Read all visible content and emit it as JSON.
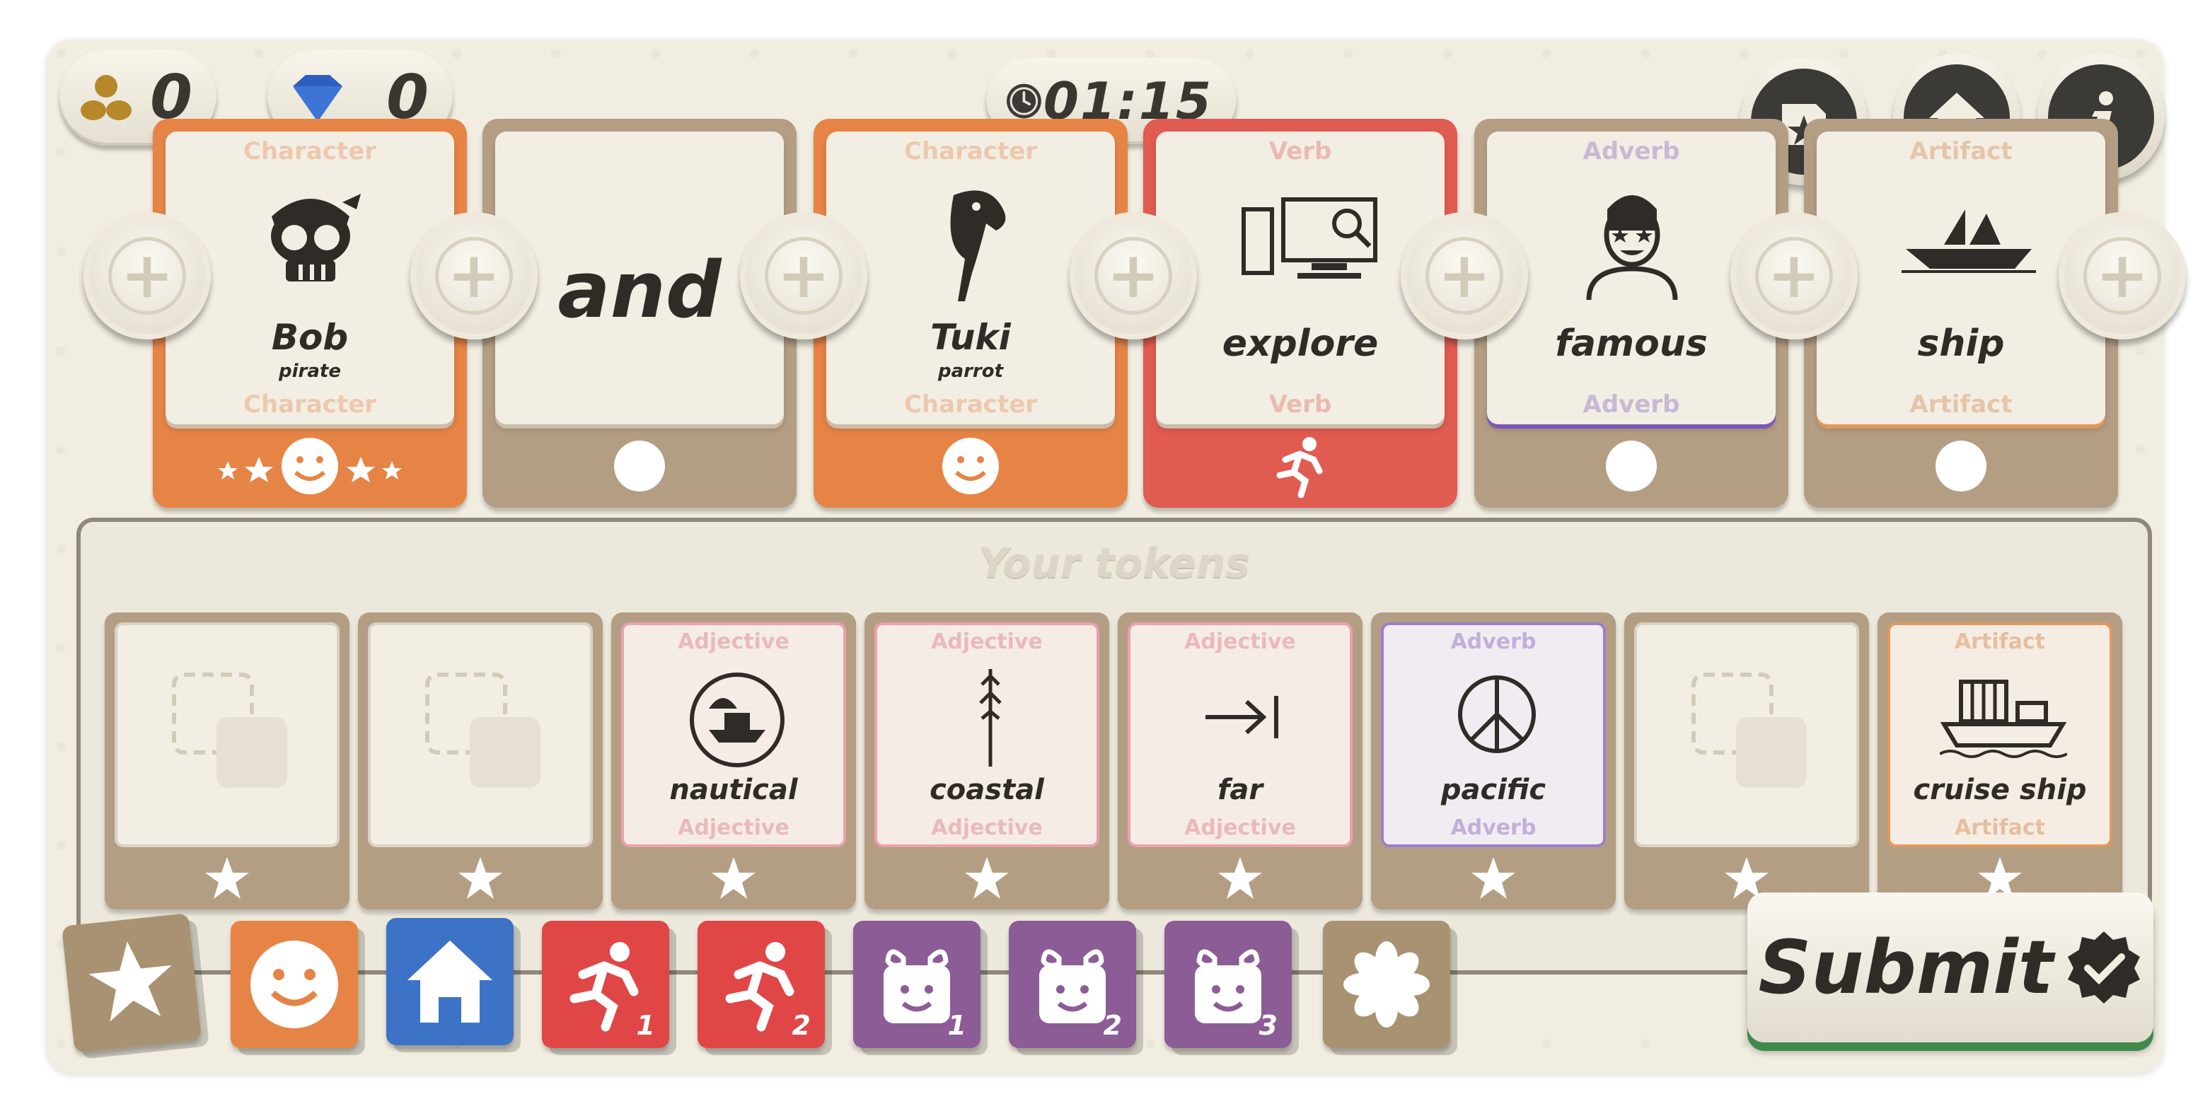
{
  "counters": {
    "gold": "0",
    "gems": "0"
  },
  "timer": "01:15",
  "sentence": [
    {
      "category": "Character",
      "word": "Bob",
      "sub": "pirate",
      "color": "#e68446"
    },
    {
      "category": "",
      "word": "and",
      "sub": "",
      "color": "#b49e83"
    },
    {
      "category": "Character",
      "word": "Tuki",
      "sub": "parrot",
      "color": "#e68446"
    },
    {
      "category": "Verb",
      "word": "explore",
      "sub": "",
      "color": "#e05b50"
    },
    {
      "category": "Adverb",
      "word": "famous",
      "sub": "",
      "color": "#b49e83"
    },
    {
      "category": "Artifact",
      "word": "ship",
      "sub": "",
      "color": "#b49e83"
    }
  ],
  "tray_title": "Your tokens",
  "tokens": [
    {
      "category": "",
      "word": ""
    },
    {
      "category": "",
      "word": ""
    },
    {
      "category": "Adjective",
      "word": "nautical"
    },
    {
      "category": "Adjective",
      "word": "coastal"
    },
    {
      "category": "Adjective",
      "word": "far"
    },
    {
      "category": "Adverb",
      "word": "pacific"
    },
    {
      "category": "",
      "word": ""
    },
    {
      "category": "Artifact",
      "word": "cruise ship"
    }
  ],
  "dice": [
    {
      "name": "star",
      "color": "#a99272",
      "num": ""
    },
    {
      "name": "smiley",
      "color": "#e68446",
      "num": ""
    },
    {
      "name": "home",
      "color": "#3c73c6",
      "num": ""
    },
    {
      "name": "runner",
      "color": "#e04646",
      "num": "1"
    },
    {
      "name": "runner",
      "color": "#e04646",
      "num": "2"
    },
    {
      "name": "gift",
      "color": "#8c5c96",
      "num": "1"
    },
    {
      "name": "gift",
      "color": "#8c5c96",
      "num": "2"
    },
    {
      "name": "gift",
      "color": "#8c5c96",
      "num": "3"
    },
    {
      "name": "flower",
      "color": "#a99272",
      "num": ""
    }
  ],
  "submit_label": "Submit"
}
